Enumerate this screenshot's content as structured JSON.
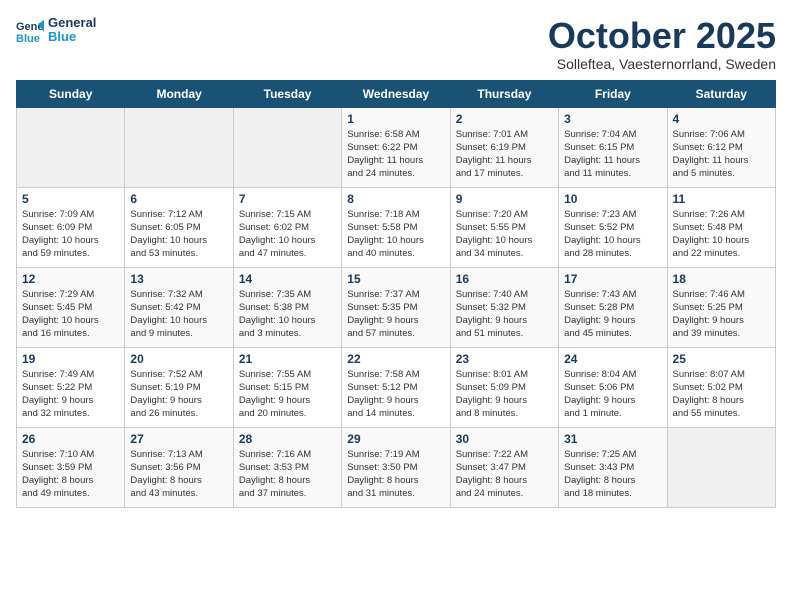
{
  "header": {
    "logo_line1": "General",
    "logo_line2": "Blue",
    "title": "October 2025",
    "subtitle": "Solleftea, Vaesternorrland, Sweden"
  },
  "days_of_week": [
    "Sunday",
    "Monday",
    "Tuesday",
    "Wednesday",
    "Thursday",
    "Friday",
    "Saturday"
  ],
  "weeks": [
    [
      {
        "day": "",
        "info": ""
      },
      {
        "day": "",
        "info": ""
      },
      {
        "day": "",
        "info": ""
      },
      {
        "day": "1",
        "info": "Sunrise: 6:58 AM\nSunset: 6:22 PM\nDaylight: 11 hours\nand 24 minutes."
      },
      {
        "day": "2",
        "info": "Sunrise: 7:01 AM\nSunset: 6:19 PM\nDaylight: 11 hours\nand 17 minutes."
      },
      {
        "day": "3",
        "info": "Sunrise: 7:04 AM\nSunset: 6:15 PM\nDaylight: 11 hours\nand 11 minutes."
      },
      {
        "day": "4",
        "info": "Sunrise: 7:06 AM\nSunset: 6:12 PM\nDaylight: 11 hours\nand 5 minutes."
      }
    ],
    [
      {
        "day": "5",
        "info": "Sunrise: 7:09 AM\nSunset: 6:09 PM\nDaylight: 10 hours\nand 59 minutes."
      },
      {
        "day": "6",
        "info": "Sunrise: 7:12 AM\nSunset: 6:05 PM\nDaylight: 10 hours\nand 53 minutes."
      },
      {
        "day": "7",
        "info": "Sunrise: 7:15 AM\nSunset: 6:02 PM\nDaylight: 10 hours\nand 47 minutes."
      },
      {
        "day": "8",
        "info": "Sunrise: 7:18 AM\nSunset: 5:58 PM\nDaylight: 10 hours\nand 40 minutes."
      },
      {
        "day": "9",
        "info": "Sunrise: 7:20 AM\nSunset: 5:55 PM\nDaylight: 10 hours\nand 34 minutes."
      },
      {
        "day": "10",
        "info": "Sunrise: 7:23 AM\nSunset: 5:52 PM\nDaylight: 10 hours\nand 28 minutes."
      },
      {
        "day": "11",
        "info": "Sunrise: 7:26 AM\nSunset: 5:48 PM\nDaylight: 10 hours\nand 22 minutes."
      }
    ],
    [
      {
        "day": "12",
        "info": "Sunrise: 7:29 AM\nSunset: 5:45 PM\nDaylight: 10 hours\nand 16 minutes."
      },
      {
        "day": "13",
        "info": "Sunrise: 7:32 AM\nSunset: 5:42 PM\nDaylight: 10 hours\nand 9 minutes."
      },
      {
        "day": "14",
        "info": "Sunrise: 7:35 AM\nSunset: 5:38 PM\nDaylight: 10 hours\nand 3 minutes."
      },
      {
        "day": "15",
        "info": "Sunrise: 7:37 AM\nSunset: 5:35 PM\nDaylight: 9 hours\nand 57 minutes."
      },
      {
        "day": "16",
        "info": "Sunrise: 7:40 AM\nSunset: 5:32 PM\nDaylight: 9 hours\nand 51 minutes."
      },
      {
        "day": "17",
        "info": "Sunrise: 7:43 AM\nSunset: 5:28 PM\nDaylight: 9 hours\nand 45 minutes."
      },
      {
        "day": "18",
        "info": "Sunrise: 7:46 AM\nSunset: 5:25 PM\nDaylight: 9 hours\nand 39 minutes."
      }
    ],
    [
      {
        "day": "19",
        "info": "Sunrise: 7:49 AM\nSunset: 5:22 PM\nDaylight: 9 hours\nand 32 minutes."
      },
      {
        "day": "20",
        "info": "Sunrise: 7:52 AM\nSunset: 5:19 PM\nDaylight: 9 hours\nand 26 minutes."
      },
      {
        "day": "21",
        "info": "Sunrise: 7:55 AM\nSunset: 5:15 PM\nDaylight: 9 hours\nand 20 minutes."
      },
      {
        "day": "22",
        "info": "Sunrise: 7:58 AM\nSunset: 5:12 PM\nDaylight: 9 hours\nand 14 minutes."
      },
      {
        "day": "23",
        "info": "Sunrise: 8:01 AM\nSunset: 5:09 PM\nDaylight: 9 hours\nand 8 minutes."
      },
      {
        "day": "24",
        "info": "Sunrise: 8:04 AM\nSunset: 5:06 PM\nDaylight: 9 hours\nand 1 minute."
      },
      {
        "day": "25",
        "info": "Sunrise: 8:07 AM\nSunset: 5:02 PM\nDaylight: 8 hours\nand 55 minutes."
      }
    ],
    [
      {
        "day": "26",
        "info": "Sunrise: 7:10 AM\nSunset: 3:59 PM\nDaylight: 8 hours\nand 49 minutes."
      },
      {
        "day": "27",
        "info": "Sunrise: 7:13 AM\nSunset: 3:56 PM\nDaylight: 8 hours\nand 43 minutes."
      },
      {
        "day": "28",
        "info": "Sunrise: 7:16 AM\nSunset: 3:53 PM\nDaylight: 8 hours\nand 37 minutes."
      },
      {
        "day": "29",
        "info": "Sunrise: 7:19 AM\nSunset: 3:50 PM\nDaylight: 8 hours\nand 31 minutes."
      },
      {
        "day": "30",
        "info": "Sunrise: 7:22 AM\nSunset: 3:47 PM\nDaylight: 8 hours\nand 24 minutes."
      },
      {
        "day": "31",
        "info": "Sunrise: 7:25 AM\nSunset: 3:43 PM\nDaylight: 8 hours\nand 18 minutes."
      },
      {
        "day": "",
        "info": ""
      }
    ]
  ]
}
